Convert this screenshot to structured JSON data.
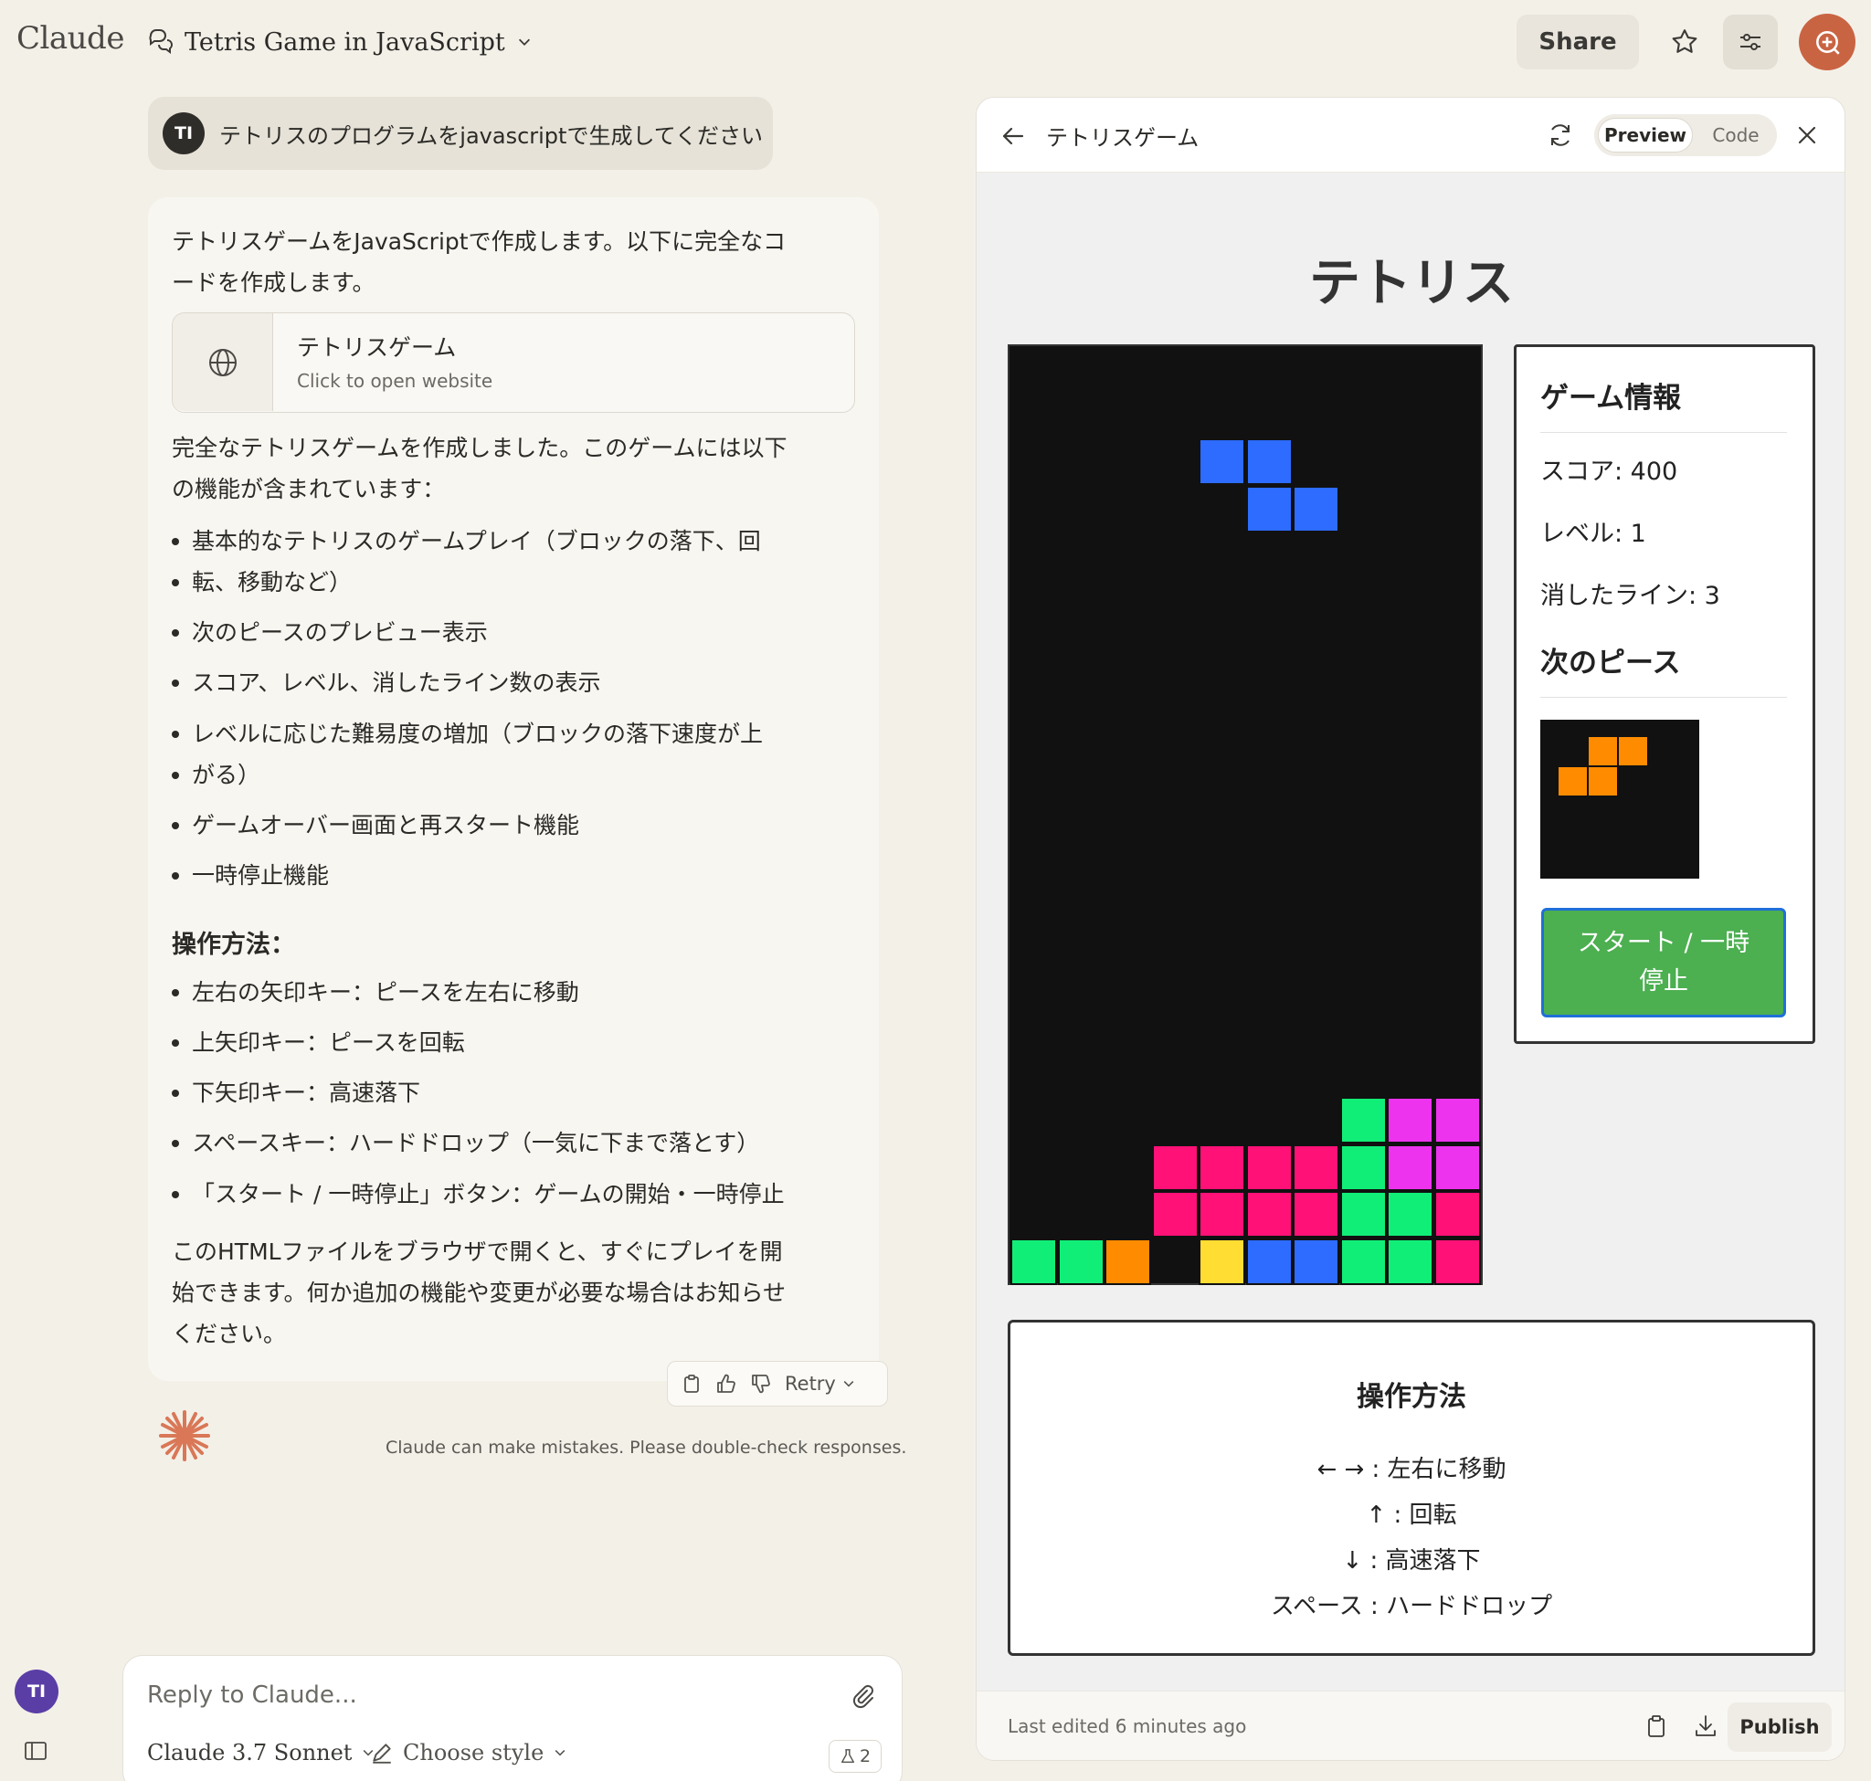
{
  "app": {
    "logo": "Claude"
  },
  "header": {
    "chat_title": "Tetris Game in JavaScript",
    "share_label": "Share",
    "accent": "#c96442"
  },
  "user_message": {
    "initials": "TI",
    "text": "テトリスのプログラムをjavascriptで生成してください"
  },
  "reply": {
    "intro_1": "テトリスゲームをJavaScriptで作成します。以下に完全なコ",
    "intro_2": "ードを作成します。",
    "artifact_title": "テトリスゲーム",
    "artifact_sub": "Click to open website",
    "summary_1": "完全なテトリスゲームを作成しました。このゲームには以下",
    "summary_2": "の機能が含まれています：",
    "features": [
      "基本的なテトリスのゲームプレイ（ブロックの落下、回",
      "転、移動など）",
      "次のピースのプレビュー表示",
      "スコア、レベル、消したライン数の表示",
      "レベルに応じた難易度の増加（ブロックの落下速度が上",
      "がる）",
      "ゲームオーバー画面と再スタート機能",
      "一時停止機能"
    ],
    "controls_heading": "操作方法：",
    "controls": [
      "左右の矢印キー：ピースを左右に移動",
      "上矢印キー：ピースを回転",
      "下矢印キー：高速落下",
      "スペースキー：ハードドロップ（一気に下まで落とす）",
      "「スタート / 一時停止」ボタン：ゲームの開始・一時停止"
    ],
    "closing_1": "このHTMLファイルをブラウザで開くと、すぐにプレイを開",
    "closing_2": "始できます。何か追加の機能や変更が必要な場合はお知らせ",
    "closing_3": "ください。",
    "retry_label": "Retry",
    "disclaimer": "Claude can make mistakes. Please double-check responses."
  },
  "composer": {
    "placeholder": "Reply to Claude...",
    "model": "Claude 3.7 Sonnet",
    "style": "Choose style",
    "count": "2",
    "user_initials": "TI"
  },
  "artifact": {
    "title": "テトリスゲーム",
    "preview_label": "Preview",
    "code_label": "Code",
    "game": {
      "title": "テトリス",
      "info_heading": "ゲーム情報",
      "score": "スコア: 400",
      "level": "レベル: 1",
      "lines": "消したライン: 3",
      "next_heading": "次のピース",
      "start_button": "スタート / 一時停止",
      "controls_heading": "操作方法",
      "controls": [
        "← → : 左右に移動",
        "↑ : 回転",
        "↓ : 高速落下",
        "スペース : ハードドロップ"
      ],
      "colors": {
        "blue": "#2d6cff",
        "pink": "#ff1177",
        "green": "#11ee77",
        "magenta": "#ee33ee",
        "orange": "#ff8c00",
        "yellow": "#ffdd33"
      }
    },
    "footer": {
      "last_edited": "Last edited 6 minutes ago",
      "publish_label": "Publish"
    }
  }
}
